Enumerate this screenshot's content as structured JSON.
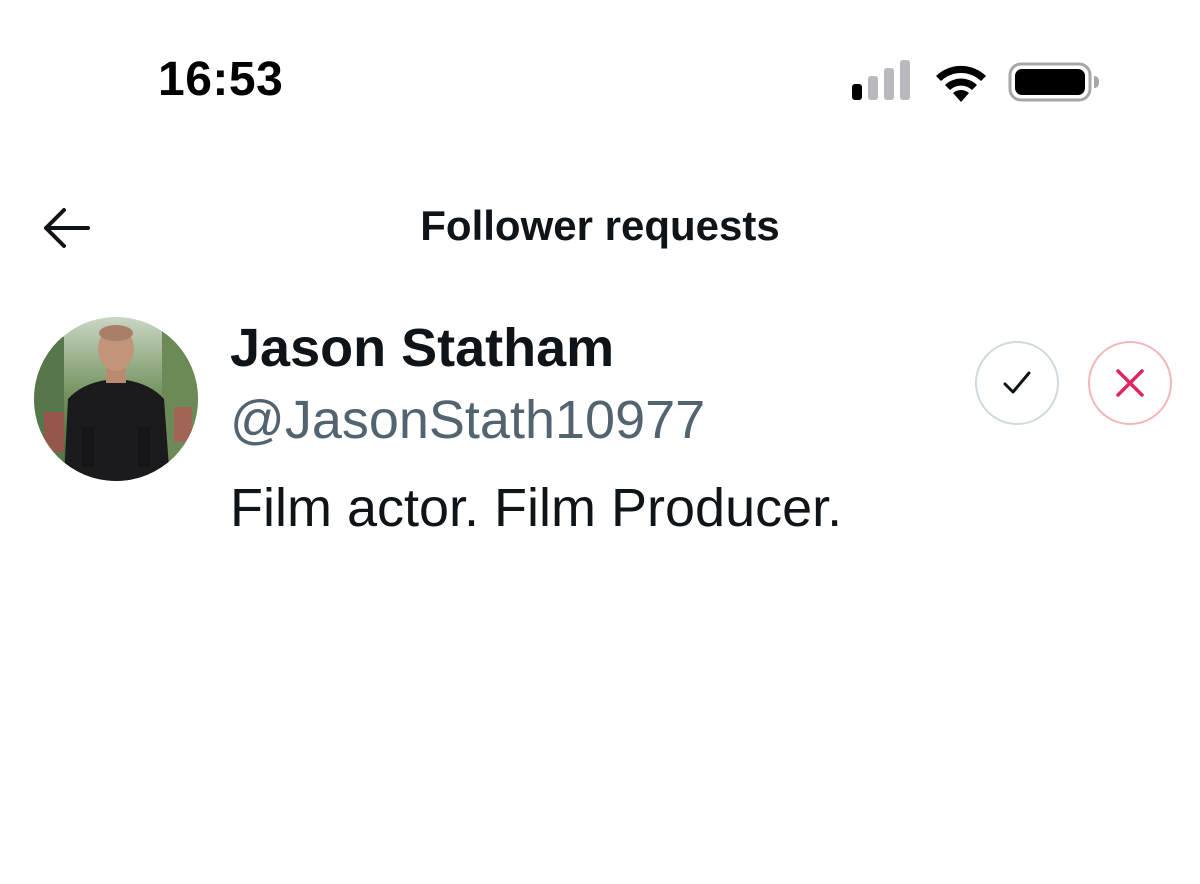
{
  "status_bar": {
    "time": "16:53"
  },
  "header": {
    "title": "Follower requests"
  },
  "requests": [
    {
      "name": "Jason Statham",
      "handle": "@JasonStath10977",
      "bio": "Film actor. Film Producer."
    }
  ],
  "colors": {
    "text_primary": "#0f1419",
    "text_secondary": "#536471",
    "accept_border": "#cfd9de",
    "decline_color": "#e0245e"
  },
  "icons": {
    "back": "arrow-left-icon",
    "accept": "checkmark-icon",
    "decline": "close-icon"
  }
}
